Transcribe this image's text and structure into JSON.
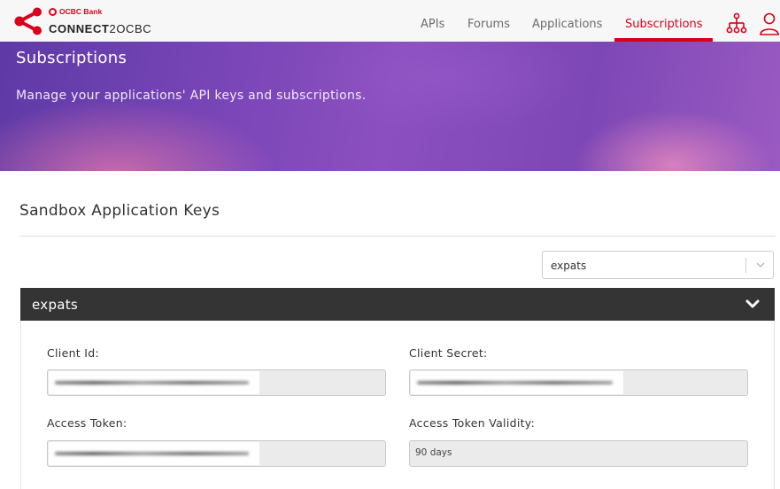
{
  "brand": {
    "bank_name": "OCBC Bank",
    "product_bold": "CONNECT",
    "product_rest": "2OCBC"
  },
  "nav": {
    "items": [
      {
        "label": "APIs"
      },
      {
        "label": "Forums"
      },
      {
        "label": "Applications"
      },
      {
        "label": "Subscriptions",
        "active": true
      }
    ],
    "icons": [
      "org-chart-icon",
      "user-icon"
    ]
  },
  "hero": {
    "title": "Subscriptions",
    "subtitle": "Manage your applications' API keys and subscriptions."
  },
  "section": {
    "title": "Sandbox Application Keys"
  },
  "app_select": {
    "value": "expats"
  },
  "panel": {
    "title": "expats",
    "fields": {
      "client_id": {
        "label": "Client Id:"
      },
      "client_secret": {
        "label": "Client Secret:"
      },
      "access_token": {
        "label": "Access Token:"
      },
      "token_validity": {
        "label": "Access Token Validity:",
        "value": "90 days"
      }
    }
  },
  "colors": {
    "accent": "#d8001a",
    "panel_header": "#343434",
    "hero_purple": "#7a46b8"
  }
}
